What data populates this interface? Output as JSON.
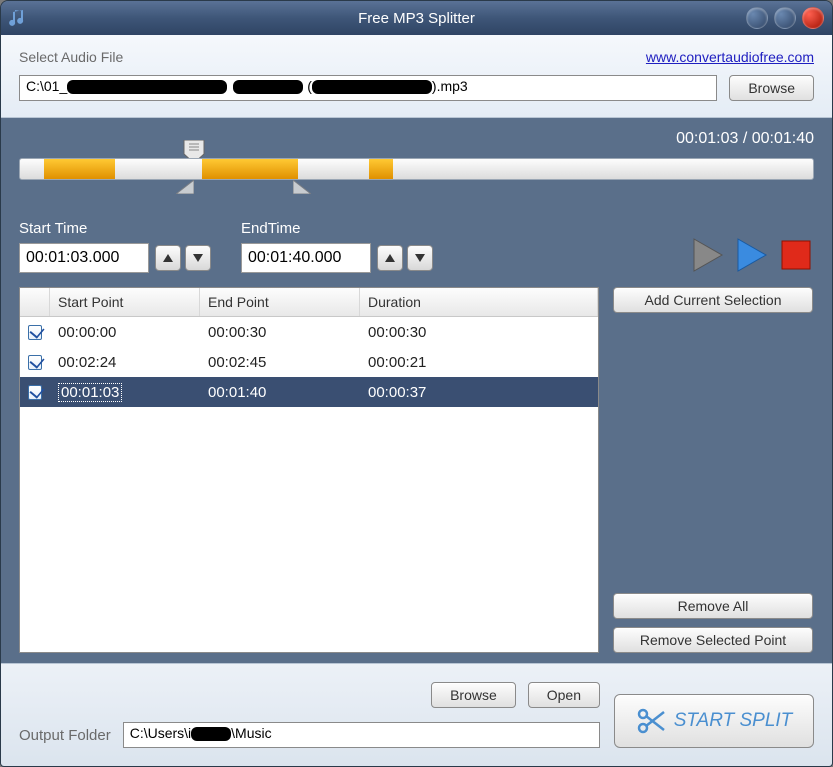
{
  "window": {
    "title": "Free MP3 Splitter"
  },
  "top": {
    "select_label": "Select Audio File",
    "link_text": "www.convertaudiofree.com",
    "file_value_prefix": "C:\\01_",
    "file_value_suffix": ").mp3",
    "browse_label": "Browse"
  },
  "time_display": {
    "current": "00:01:03",
    "sep": " / ",
    "total": "00:01:40"
  },
  "track": {
    "segments": [
      {
        "left_pct": 3,
        "width_pct": 9
      },
      {
        "left_pct": 23,
        "width_pct": 12
      },
      {
        "left_pct": 44,
        "width_pct": 3
      }
    ],
    "indicator_pos_pct": 22,
    "start_handle_pct": 22,
    "end_handle_pct": 34.5
  },
  "start_time": {
    "label": "Start Time",
    "value": "00:01:03.000"
  },
  "end_time": {
    "label": "EndTime",
    "value": "00:01:40.000"
  },
  "table": {
    "headers": {
      "col0": "",
      "col1": "Start Point",
      "col2": "End Point",
      "col3": "Duration"
    },
    "rows": [
      {
        "checked": true,
        "start": "00:00:00",
        "end": "00:00:30",
        "dur": "00:00:30",
        "selected": false
      },
      {
        "checked": true,
        "start": "00:02:24",
        "end": "00:02:45",
        "dur": "00:00:21",
        "selected": false
      },
      {
        "checked": true,
        "start": "00:01:03",
        "end": "00:01:40",
        "dur": "00:00:37",
        "selected": true
      }
    ]
  },
  "buttons": {
    "add_selection": "Add Current Selection",
    "remove_all": "Remove All",
    "remove_selected": "Remove Selected Point",
    "browse": "Browse",
    "open": "Open",
    "start_split": "START SPLIT"
  },
  "output": {
    "label": "Output Folder",
    "value_prefix": "C:\\Users\\i",
    "value_suffix": "\\Music"
  }
}
